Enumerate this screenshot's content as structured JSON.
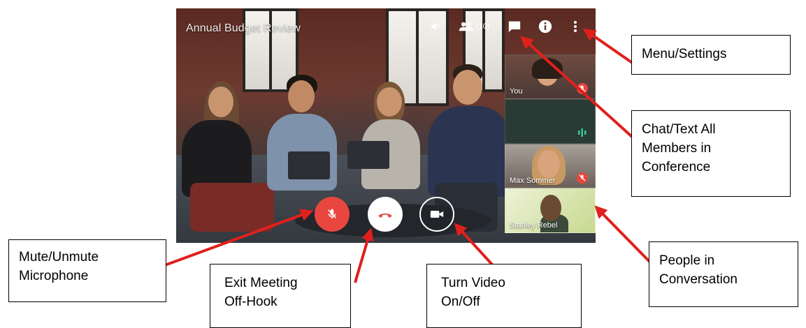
{
  "meeting": {
    "title": "Annual Budget Review",
    "participant_count": "(10)"
  },
  "top_bar_icons": [
    "volume-icon",
    "people-icon",
    "chat-icon",
    "info-icon",
    "more-vert-icon"
  ],
  "participants": [
    {
      "name": "You",
      "muted": true
    },
    {
      "name": "",
      "speaking": true
    },
    {
      "name": "Max Sommer",
      "muted": true
    },
    {
      "name": "Stanley Rebel",
      "muted": false
    }
  ],
  "controls": {
    "mic_icon": "mic-off-icon",
    "hangup_icon": "hangup-icon",
    "video_icon": "video-camera-icon"
  },
  "annotations": {
    "menu_settings": "Menu/Settings",
    "chat": "Chat/Text All\nMembers in\nConference",
    "people": "People in\nConversation",
    "mute": "Mute/Unmute\nMicrophone",
    "exit": "Exit Meeting\nOff-Hook",
    "video": "Turn Video\nOn/Off"
  },
  "colors": {
    "mute_red": "#e8463f",
    "hangup_red": "#e8463f",
    "arrow_red": "#e0201c"
  }
}
